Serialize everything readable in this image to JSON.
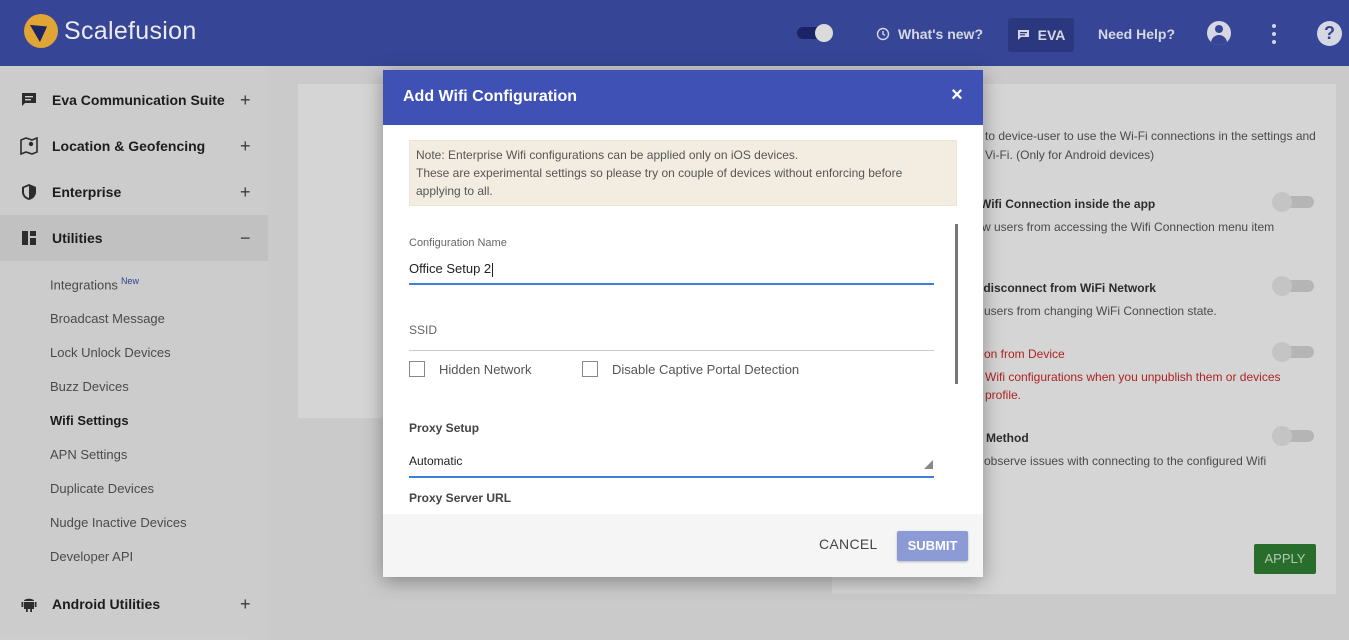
{
  "header": {
    "brand": "Scalefusion",
    "whats_new": "What's new?",
    "eva": "EVA",
    "need_help": "Need Help?",
    "help_glyph": "?",
    "theme_toggle_on": true,
    "colors": {
      "bar": "#3b4ba3",
      "accent": "#3f51b5"
    }
  },
  "sidebar": {
    "sections": [
      {
        "label": "Eva Communication Suite",
        "icon": "chat-icon",
        "toggle": "+"
      },
      {
        "label": "Location & Geofencing",
        "icon": "map-pin-icon",
        "toggle": "+"
      },
      {
        "label": "Enterprise",
        "icon": "shield-icon",
        "toggle": "+"
      },
      {
        "label": "Utilities",
        "icon": "dashboard-icon",
        "toggle": "−"
      },
      {
        "label": "Android Utilities",
        "icon": "android-icon",
        "toggle": "+"
      }
    ],
    "sub_items": [
      {
        "label": "Integrations",
        "badge": "New"
      },
      {
        "label": "Broadcast Message"
      },
      {
        "label": "Lock Unlock Devices"
      },
      {
        "label": "Buzz Devices"
      },
      {
        "label": "Wifi Settings"
      },
      {
        "label": "APN Settings"
      },
      {
        "label": "Duplicate Devices"
      },
      {
        "label": "Nudge Inactive Devices"
      },
      {
        "label": "Developer API"
      }
    ]
  },
  "background": {
    "desc_line1": "to device-user to use the Wi-Fi connections in the settings and",
    "desc_line2": "Vi-Fi. (Only for Android devices)",
    "opt1_title": "Wifi Connection inside the app",
    "opt1_desc": "w users from accessing the Wifi Connection menu item",
    "opt2_title": "/disconnect from WiFi Network",
    "opt2_desc": "users from changing WiFi Connection state.",
    "opt3_title": "on from Device",
    "opt3_desc1": "Wifi configurations when you unpublish them or devices",
    "opt3_desc2": "profile.",
    "opt4_title": "Method",
    "opt4_desc": "observe issues with connecting to the configured Wifi",
    "apply_label": "APPLY"
  },
  "modal": {
    "title": "Add Wifi Configuration",
    "close_glyph": "×",
    "note_line1": "Note: Enterprise Wifi configurations can be applied only on iOS devices.",
    "note_line2": "These are experimental settings so please try on couple of devices without enforcing before",
    "note_line3": "applying to all.",
    "config_name_label": "Configuration Name",
    "config_name_value": "Office Setup 2",
    "ssid_placeholder": "SSID",
    "hidden_network_label": "Hidden Network",
    "captive_portal_label": "Disable Captive Portal Detection",
    "proxy_setup_label": "Proxy Setup",
    "proxy_setup_value": "Automatic",
    "proxy_url_label": "Proxy Server URL",
    "cancel_label": "CANCEL",
    "submit_label": "SUBMIT"
  }
}
